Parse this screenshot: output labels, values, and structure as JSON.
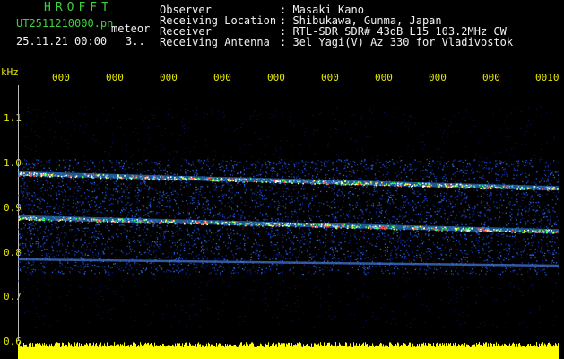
{
  "app": {
    "title": "HROFFT"
  },
  "file": {
    "name": "UT2511210000.pn",
    "tag": "meteor",
    "datetime": "25.11.21 00:00",
    "page_indicator": "3.."
  },
  "header": [
    {
      "label": "Observer",
      "value": ": Masaki Kano"
    },
    {
      "label": "Receiving Location",
      "value": ": Shibukawa, Gunma, Japan"
    },
    {
      "label": "Receiver",
      "value": ": RTL-SDR SDR# 43dB L15 103.2MHz CW"
    },
    {
      "label": "Receiving Antenna",
      "value": ": 3el Yagi(V) Az 330 for Vladivostok"
    }
  ],
  "chart_data": {
    "type": "heatmap",
    "ylabel": "kHz",
    "ylim": [
      0.6,
      1.2
    ],
    "y_ticks": [
      "1.1",
      "1.0",
      "0.9",
      "0.8",
      "0.7",
      "0.6"
    ],
    "x_ticks": [
      "000",
      "000",
      "000",
      "000",
      "000",
      "000",
      "000",
      "000",
      "000",
      "0010"
    ],
    "traces_khz": [
      {
        "start": 1.0,
        "end": 0.965
      },
      {
        "start": 0.895,
        "end": 0.862
      },
      {
        "start": 0.795,
        "end": 0.78
      }
    ]
  },
  "colors": {
    "header_text": "#f2f2f2",
    "title_text": "#3cd23c",
    "tick_text": "#e8e800",
    "power_strip": "#ffff00"
  }
}
